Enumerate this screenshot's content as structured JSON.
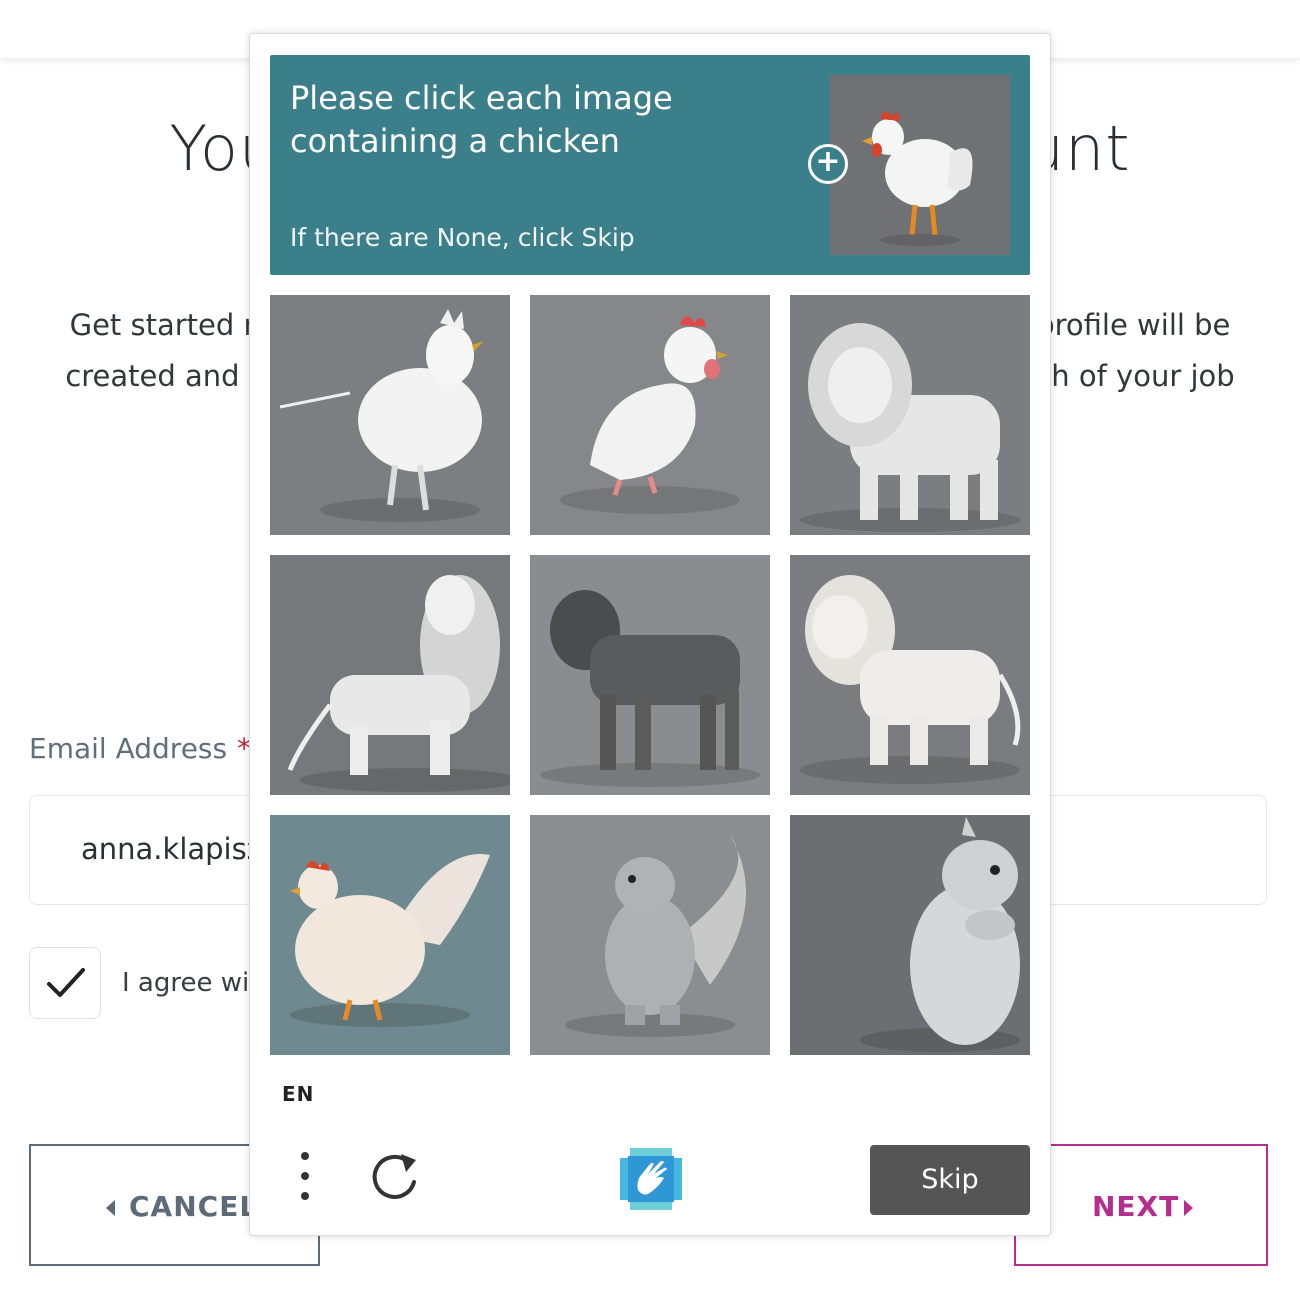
{
  "page": {
    "title": "You                                    unt",
    "intro_line1": "Get started n                                                                                    profile will be",
    "intro_line2": "created and k                                                                                    th of your job",
    "email_label": "Email Address",
    "email_required_mark": "*",
    "email_value": "anna.klapisz",
    "agree_text": "I agree wit",
    "checkbox_checked": true,
    "cancel_label": "CANCEL",
    "next_label": "NEXT",
    "colors": {
      "cancel": "#5d6b78",
      "next": "#b52d8f"
    }
  },
  "captcha": {
    "prompt_title": "Please click each image containing a chicken",
    "prompt_sub": "If there are None, click Skip",
    "example_icon": "chicken-example-image",
    "tiles": [
      {
        "subject": "chicken",
        "icon": "chicken-image"
      },
      {
        "subject": "chicken",
        "icon": "chicken-image"
      },
      {
        "subject": "lion",
        "icon": "lion-image"
      },
      {
        "subject": "lion",
        "icon": "lion-image"
      },
      {
        "subject": "lion",
        "icon": "lion-image"
      },
      {
        "subject": "lion",
        "icon": "lion-image"
      },
      {
        "subject": "chicken",
        "icon": "chicken-image"
      },
      {
        "subject": "squirrel",
        "icon": "squirrel-image"
      },
      {
        "subject": "squirrel",
        "icon": "squirrel-image"
      }
    ],
    "language": "EN",
    "skip_label": "Skip",
    "accent_color": "#3a7f89"
  }
}
